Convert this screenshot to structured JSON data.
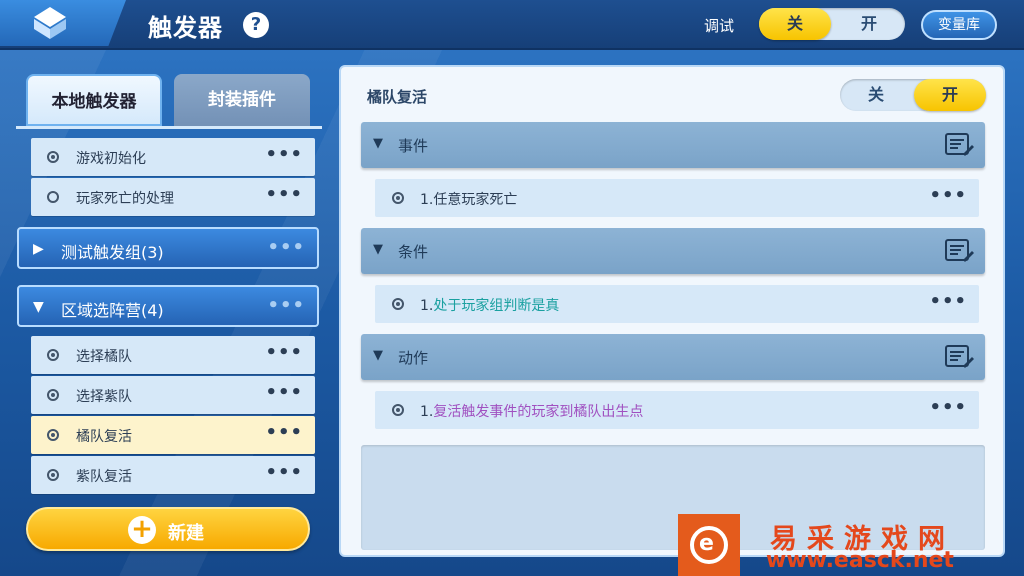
{
  "header": {
    "title": "触发器",
    "help_glyph": "?",
    "debug_label": "调试",
    "debug_toggle": {
      "off": "关",
      "on": "开",
      "state": "off"
    },
    "variable_library": "变量库"
  },
  "left": {
    "tabs": [
      {
        "label": "本地触发器",
        "active": true
      },
      {
        "label": "封装插件",
        "active": false
      }
    ],
    "items_top": [
      {
        "label": "游戏初始化",
        "selected_radio": true
      },
      {
        "label": "玩家死亡的处理",
        "selected_radio": false
      }
    ],
    "groups": [
      {
        "label": "测试触发组(3)",
        "expanded": false
      },
      {
        "label": "区域选阵营(4)",
        "expanded": true
      }
    ],
    "items_group": [
      {
        "label": "选择橘队"
      },
      {
        "label": "选择紫队"
      },
      {
        "label": "橘队复活",
        "highlighted": true
      },
      {
        "label": "紫队复活"
      }
    ],
    "more_glyph": "•••",
    "new_button": {
      "plus": "+",
      "label": "新建"
    }
  },
  "right": {
    "trigger_name": "橘队复活",
    "enable_toggle": {
      "off": "关",
      "on": "开",
      "state": "on"
    },
    "sections": [
      {
        "label": "事件",
        "row": {
          "prefix": "1.",
          "text": "任意玩家死亡"
        }
      },
      {
        "label": "条件",
        "row": {
          "prefix": "1.",
          "text": "处于玩家组判断是真"
        }
      },
      {
        "label": "动作",
        "row": {
          "prefix": "1.",
          "text": "复活触发事件的玩家到橘队出生点"
        }
      }
    ]
  },
  "watermark": {
    "logo_letter": "e",
    "cn": "易采游戏网",
    "url": "www.easck.net"
  },
  "colors": {
    "accent_yellow": "#f7c400",
    "panel_blue": "#2563b4",
    "row_bg": "#d6e8f8",
    "highlight_row": "#fdf3cc",
    "condition_text": "#1aa0a0",
    "action_text": "#a050c0",
    "watermark": "#e4481c"
  }
}
